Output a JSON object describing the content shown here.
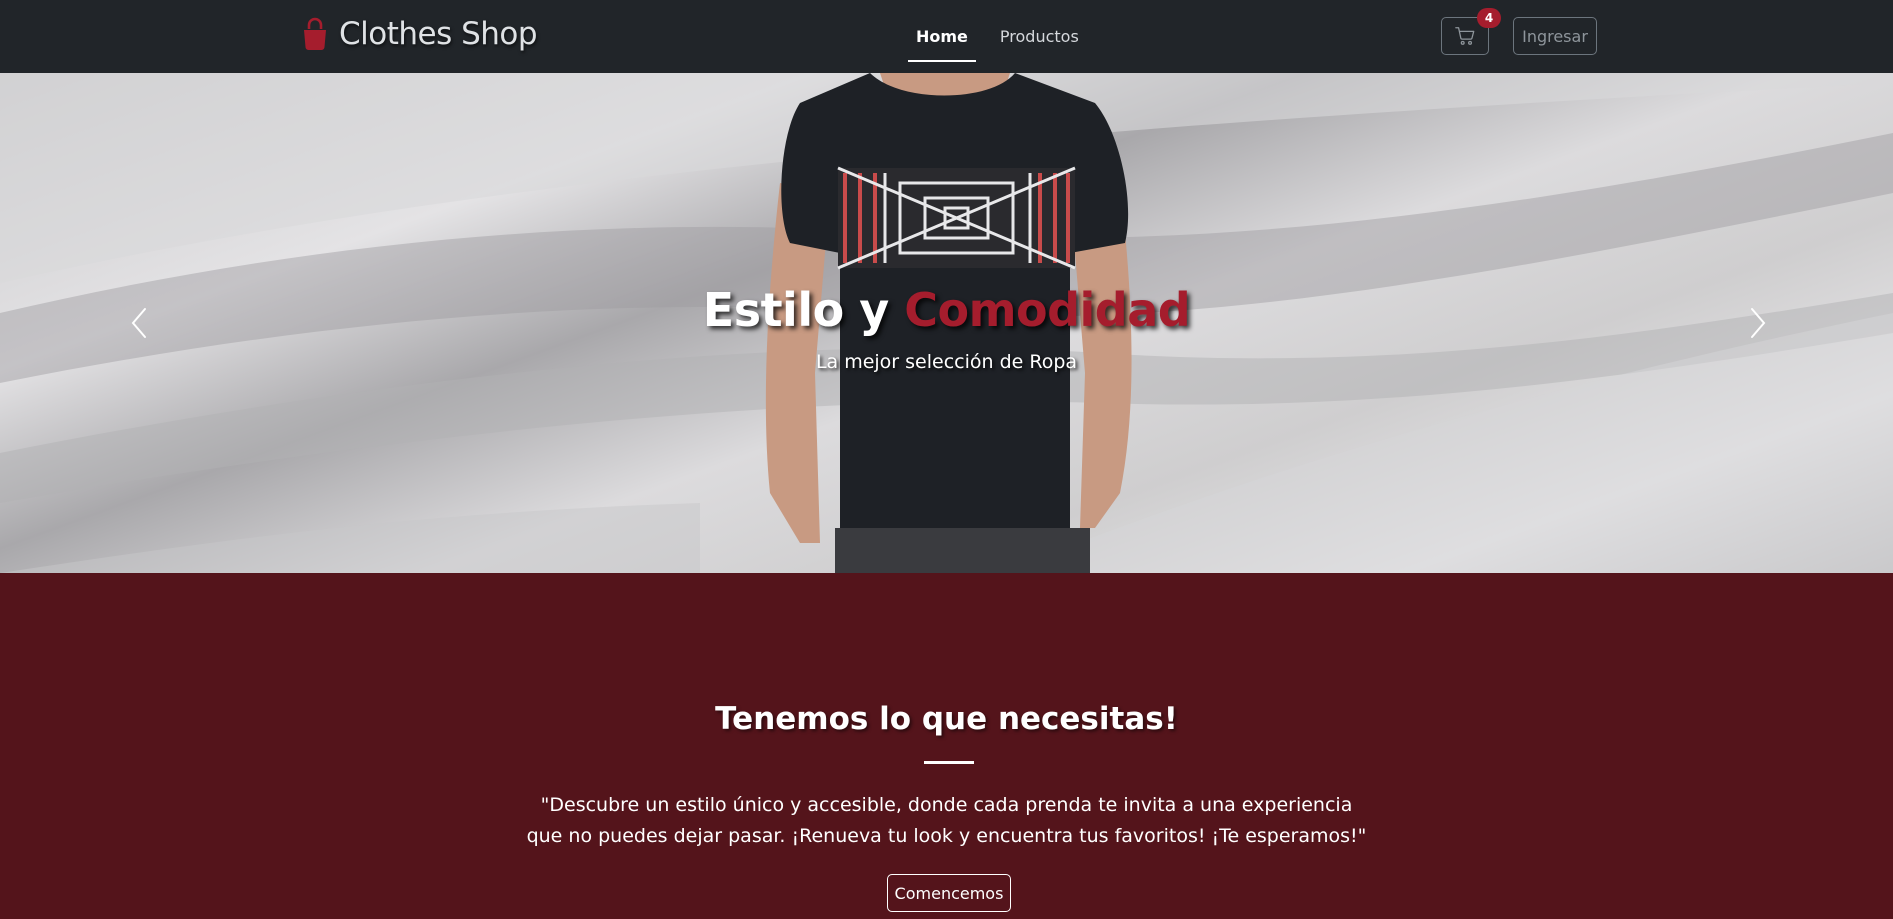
{
  "navbar": {
    "brand": "Clothes Shop",
    "brand_icon": "shopping-bag-icon",
    "links": [
      {
        "label": "Home",
        "active": true
      },
      {
        "label": "Productos",
        "active": false
      }
    ],
    "cart_icon": "cart-icon",
    "cart_count": "4",
    "login_label": "Ingresar"
  },
  "hero": {
    "title_part1": "Estilo y ",
    "title_accent": "Comodidad",
    "subtitle": "La mejor selección de Ropa",
    "prev_icon": "chevron-left-icon",
    "next_icon": "chevron-right-icon"
  },
  "section": {
    "title": "Tenemos lo que necesitas!",
    "text": "\"Descubre un estilo único y accesible, donde cada prenda te invita a una experiencia que no puedes dejar pasar. ¡Renueva tu look y encuentra tus favoritos! ¡Te esperamos!\"",
    "button_label": "Comencemos"
  },
  "colors": {
    "navbar_bg": "#212529",
    "accent": "#a51d2d",
    "section_bg": "#54141b"
  }
}
